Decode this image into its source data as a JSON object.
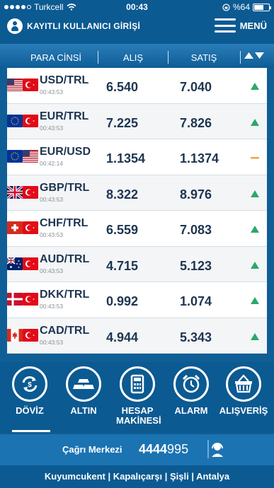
{
  "status_bar": {
    "carrier": "Turkcell",
    "time": "00:43",
    "battery": "%64"
  },
  "header": {
    "login_label": "KAYITLI KULLANICI GİRİŞİ",
    "menu_label": "MENÜ"
  },
  "table": {
    "col_name": "PARA CİNSİ",
    "col_buy": "ALIŞ",
    "col_sell": "SATIŞ",
    "rows": [
      {
        "pair": "USD/TRL",
        "time": "00:43:53",
        "buy": "6.540",
        "sell": "7.040",
        "trend": "up"
      },
      {
        "pair": "EUR/TRL",
        "time": "00:43:53",
        "buy": "7.225",
        "sell": "7.826",
        "trend": "up"
      },
      {
        "pair": "EUR/USD",
        "time": "00:42:14",
        "buy": "1.1354",
        "sell": "1.1374",
        "trend": "flat"
      },
      {
        "pair": "GBP/TRL",
        "time": "00:43:53",
        "buy": "8.322",
        "sell": "8.976",
        "trend": "up"
      },
      {
        "pair": "CHF/TRL",
        "time": "00:43:53",
        "buy": "6.559",
        "sell": "7.083",
        "trend": "up"
      },
      {
        "pair": "AUD/TRL",
        "time": "00:43:53",
        "buy": "4.715",
        "sell": "5.123",
        "trend": "up"
      },
      {
        "pair": "DKK/TRL",
        "time": "00:43:53",
        "buy": "0.992",
        "sell": "1.074",
        "trend": "up"
      },
      {
        "pair": "CAD/TRL",
        "time": "00:43:53",
        "buy": "4.944",
        "sell": "5.343",
        "trend": "up"
      }
    ]
  },
  "nav": {
    "items": [
      {
        "label": "DÖVİZ",
        "icon": "exchange-icon"
      },
      {
        "label": "ALTIN",
        "icon": "gold-bars-icon"
      },
      {
        "label": "HESAP MAKİNESİ",
        "icon": "calculator-icon"
      },
      {
        "label": "ALARM",
        "icon": "alarm-clock-icon"
      },
      {
        "label": "ALIŞVERİŞ",
        "icon": "shopping-basket-icon"
      }
    ]
  },
  "call_center": {
    "label": "Çağrı Merkezi",
    "number_bold": "4444",
    "number_rest": "995"
  },
  "footer": {
    "text": "Kuyumcukent | Kapalıçarşı | Şişli | Antalya"
  },
  "colors": {
    "up": "#2ca86b",
    "flat": "#f2a33a",
    "brand": "#0c5a92"
  }
}
